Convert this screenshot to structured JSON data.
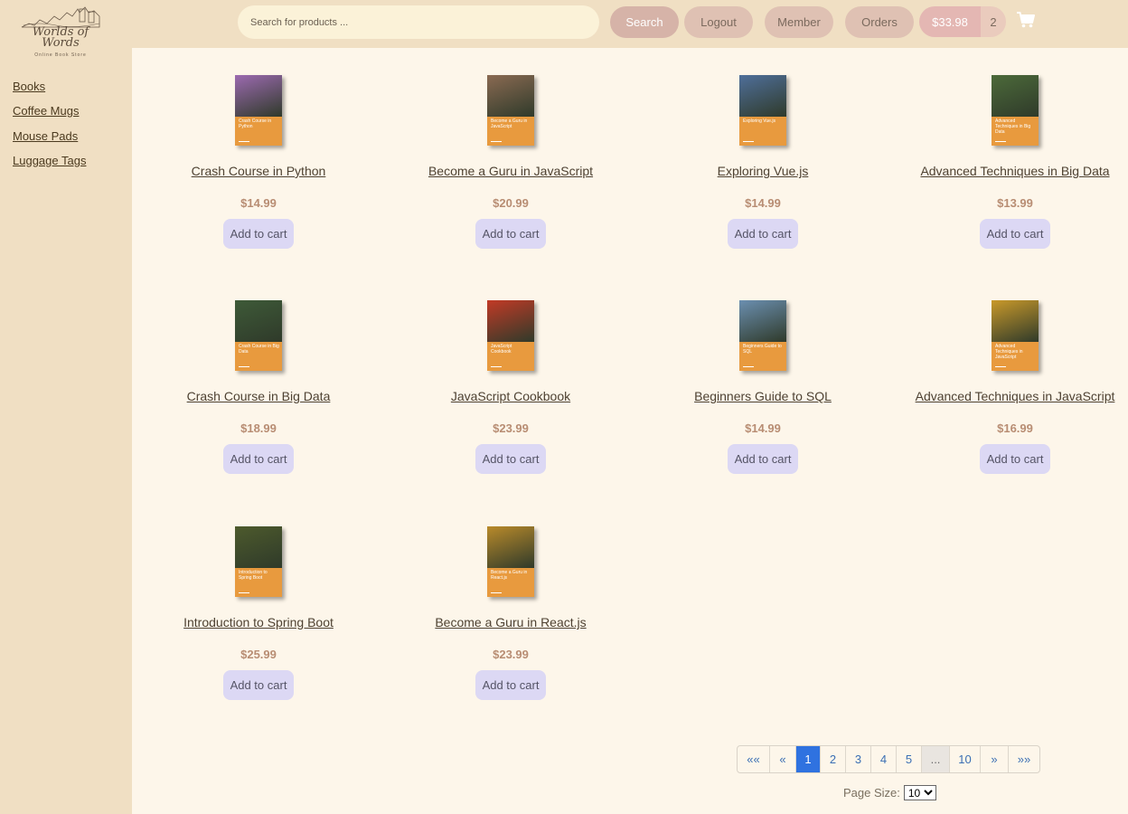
{
  "brand": {
    "title": "Worlds of Words",
    "subtitle": "Online Book Store"
  },
  "header": {
    "search_placeholder": "Search for products ...",
    "search_label": "Search",
    "logout_label": "Logout",
    "member_label": "Member",
    "orders_label": "Orders",
    "cart_total": "$33.98",
    "cart_count": "2"
  },
  "sidebar": {
    "items": [
      {
        "label": "Books"
      },
      {
        "label": "Coffee Mugs"
      },
      {
        "label": "Mouse Pads"
      },
      {
        "label": "Luggage Tags"
      }
    ]
  },
  "products": [
    {
      "title": "Crash Course in Python",
      "cover_text": "Crash Course in Python",
      "price": "$14.99",
      "button": "Add to cart",
      "photo": "#9c6ab0"
    },
    {
      "title": "Become a Guru in JavaScript",
      "cover_text": "Become a Guru in JavaScript",
      "price": "$20.99",
      "button": "Add to cart",
      "photo": "#8a6a52"
    },
    {
      "title": "Exploring Vue.js",
      "cover_text": "Exploring Vue.js",
      "price": "$14.99",
      "button": "Add to cart",
      "photo": "#4f6f9a"
    },
    {
      "title": "Advanced Techniques in Big Data",
      "cover_text": "Advanced Techniques in Big Data",
      "price": "$13.99",
      "button": "Add to cart",
      "photo": "#4c6a3a"
    },
    {
      "title": "Crash Course in Big Data",
      "cover_text": "Crash Course in Big Data",
      "price": "$18.99",
      "button": "Add to cart",
      "photo": "#3e5a38"
    },
    {
      "title": "JavaScript Cookbook",
      "cover_text": "JavaScript Cookbook",
      "price": "$23.99",
      "button": "Add to cart",
      "photo": "#c23a26"
    },
    {
      "title": "Beginners Guide to SQL",
      "cover_text": "Beginners Guide to SQL",
      "price": "$14.99",
      "button": "Add to cart",
      "photo": "#6b8fb0"
    },
    {
      "title": "Advanced Techniques in JavaScript",
      "cover_text": "Advanced Techniques in JavaScript",
      "price": "$16.99",
      "button": "Add to cart",
      "photo": "#c9992a"
    },
    {
      "title": "Introduction to Spring Boot",
      "cover_text": "Introduction to Spring Boot",
      "price": "$25.99",
      "button": "Add to cart",
      "photo": "#4d5a2c"
    },
    {
      "title": "Become a Guru in React.js",
      "cover_text": "Become a Guru in React.js",
      "price": "$23.99",
      "button": "Add to cart",
      "photo": "#b98a2a"
    }
  ],
  "pagination": {
    "first": "«« ",
    "prev": "«",
    "pages": [
      "1",
      "2",
      "3",
      "4",
      "5"
    ],
    "ellipsis": "...",
    "last_page": "10",
    "next": "»",
    "last": "»»",
    "current": "1"
  },
  "page_size": {
    "label": "Page Size:",
    "value": "10"
  }
}
